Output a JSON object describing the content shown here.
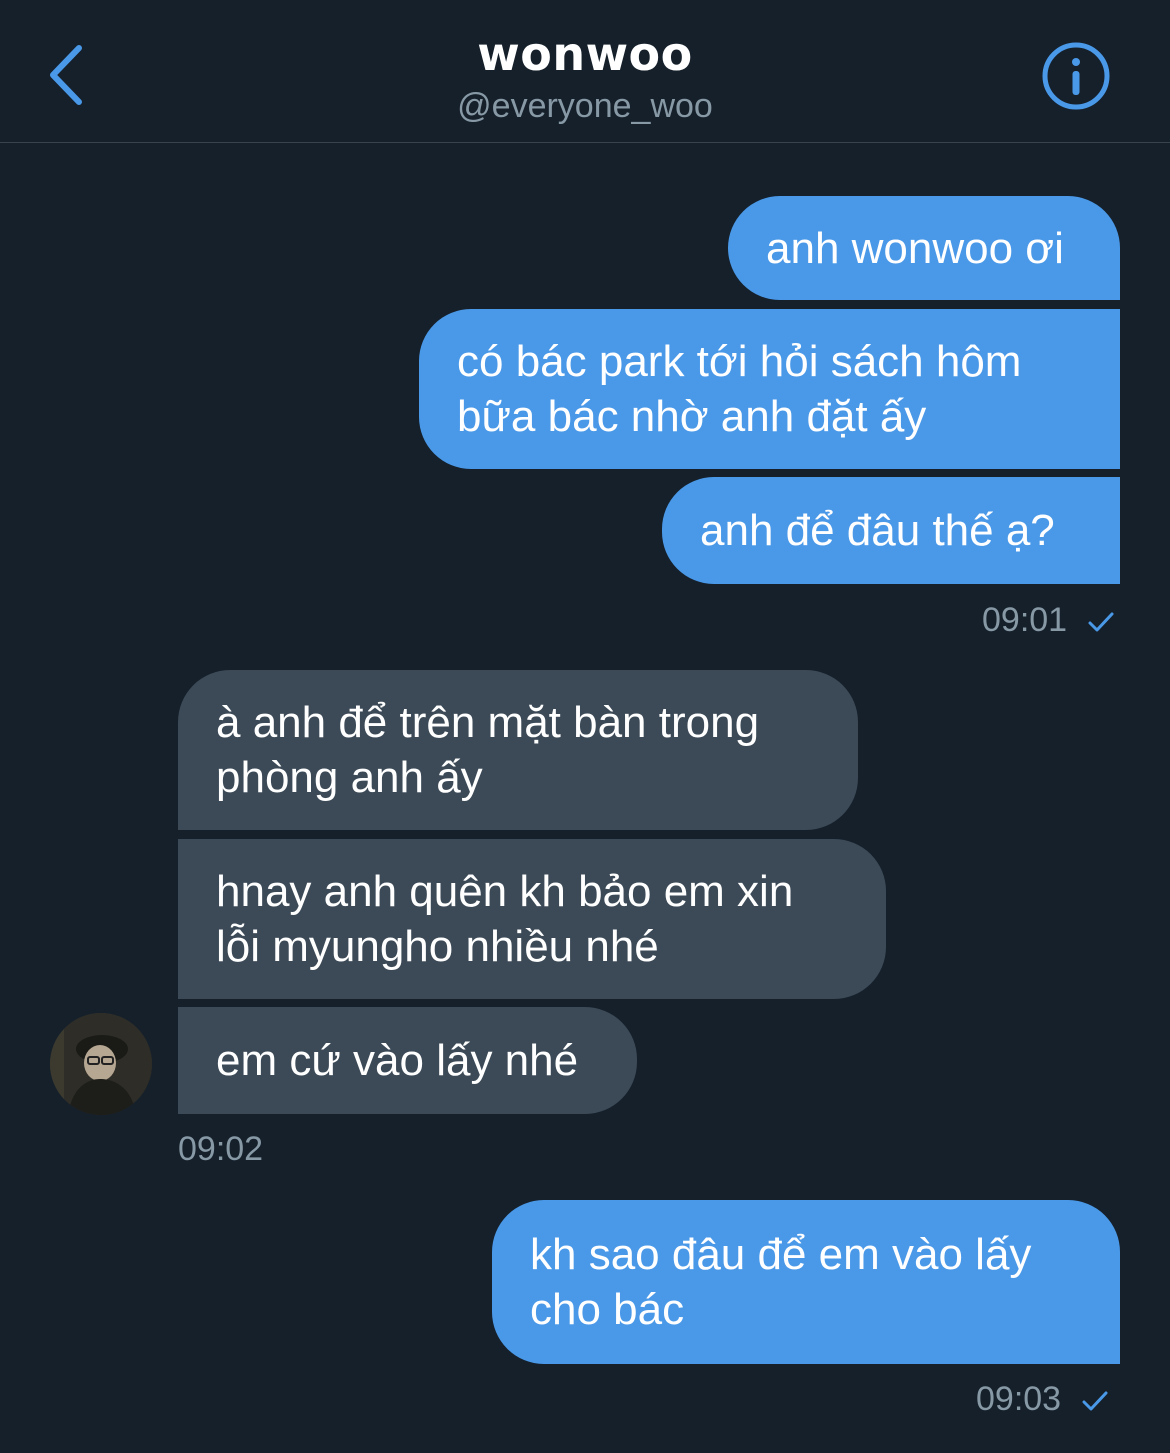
{
  "header": {
    "name": "wonwoo",
    "handle": "@everyone_woo",
    "back_icon": "chevron-left-icon",
    "info_icon": "info-circle-icon",
    "accent_color": "#4a99e9"
  },
  "messages": [
    {
      "from": "me",
      "text": "anh wonwoo ơi"
    },
    {
      "from": "me",
      "text": "có bác park tới hỏi sách hôm bữa bác nhờ anh đặt ấy"
    },
    {
      "from": "me",
      "text": "anh để đâu thế ạ?"
    },
    {
      "from": "them",
      "text": "à anh để trên mặt bàn trong phòng anh ấy"
    },
    {
      "from": "them",
      "text": "hnay anh quên kh bảo em xin lỗi myungho nhiều nhé"
    },
    {
      "from": "them",
      "text": "em cứ vào lấy nhé"
    },
    {
      "from": "me",
      "text": "kh sao đâu để em vào lấy cho bác"
    }
  ],
  "timestamps": {
    "sent_1": "09:01",
    "recv_1": "09:02",
    "sent_2": "09:03"
  },
  "colors": {
    "background": "#15202b",
    "sent_bubble": "#4a99e9",
    "received_bubble": "#3c4a57",
    "muted_text": "#8899a6"
  }
}
